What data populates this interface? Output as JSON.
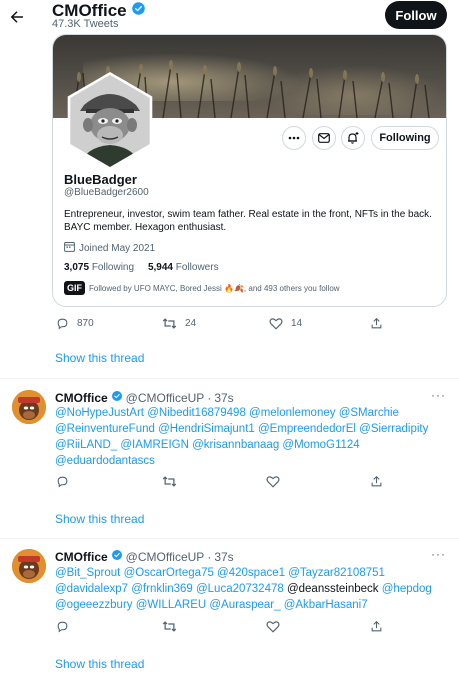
{
  "header": {
    "title": "CMOffice",
    "subtitle": "47.3K Tweets",
    "follow_label": "Follow"
  },
  "profile_card": {
    "name": "BlueBadger",
    "handle": "@BlueBadger2600",
    "bio": "Entrepreneur, investor, swim team father. Real estate in the front, NFTs in the back. BAYC member. Hexagon enthusiast.",
    "joined": "Joined May 2021",
    "following_count": "3,075",
    "following_label": "Following",
    "followers_count": "5,944",
    "followers_label": "Followers",
    "followed_by": "Followed by UFO MAYC, Bored Jessi 🔥🍂, and 493 others you follow",
    "gif_badge": "GIF",
    "following_button": "Following"
  },
  "first_actions": {
    "replies": "870",
    "retweets": "24",
    "likes": "14"
  },
  "show_thread_label": "Show this thread",
  "tweets": [
    {
      "name": "CMOffice",
      "handle": "@CMOfficeUP",
      "separator": "·",
      "time": "37s",
      "more": "···",
      "lines": [
        "@NoHypeJustArt @Nibedit16879498 @melonlemoney @SMarchie",
        "@ReinventureFund @HendriSimajunt1 @EmpreendedorEl @Sierradipity",
        "@RiiLAND_ @IAMREIGN @krisannbanaag @MomoG1124",
        "@eduardodantascs"
      ]
    },
    {
      "name": "CMOffice",
      "handle": "@CMOfficeUP",
      "separator": "·",
      "time": "37s",
      "more": "···",
      "lines": [
        "@Bit_Sprout @OscarOrtega75 @420space1 @Tayzar82108751",
        "@davidalexp7 @frnklin369 @Luca20732478",
        "@ogeeezzbury @WILLAREU @Auraspear_ @AkbarHasani7"
      ],
      "line2_suffix_plain": " @deanssteinbeck ",
      "line2_suffix_mention": "@hepdog"
    }
  ],
  "colors": {
    "accent": "#1d9bf0",
    "text": "#0f1419",
    "muted": "#536471",
    "border": "#cfd9de"
  }
}
